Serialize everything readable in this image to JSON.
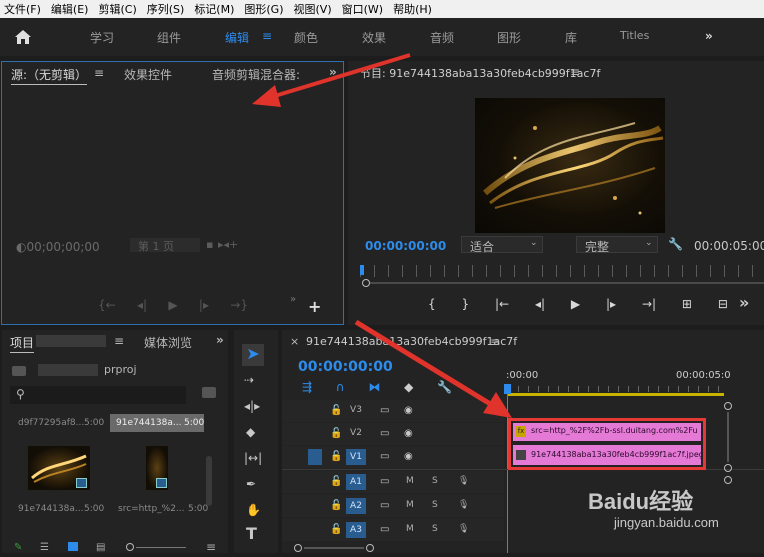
{
  "menu": [
    "文件(F)",
    "编辑(E)",
    "剪辑(C)",
    "序列(S)",
    "标记(M)",
    "图形(G)",
    "视图(V)",
    "窗口(W)",
    "帮助(H)"
  ],
  "workspace": {
    "tabs": [
      "学习",
      "组件",
      "编辑",
      "颜色",
      "效果",
      "音频",
      "图形",
      "库",
      "Titles"
    ],
    "active": "编辑"
  },
  "source_panel": {
    "tabs": [
      "源:（无剪辑）",
      "效果控件",
      "音频剪辑混合器:"
    ],
    "timecode": "00;00;00;00",
    "page": "第 1 页"
  },
  "program_panel": {
    "title": "节目: 91e744138aba13a30feb4cb999f1ac7f",
    "timecode": "00:00:00:00",
    "fit": "适合",
    "quality": "完整",
    "duration": "00:00:05:00"
  },
  "project_panel": {
    "tabs": [
      "项目",
      "媒体浏览"
    ],
    "project_name": "prproj",
    "items": [
      {
        "name": "d9f77295af8...",
        "dur": "5:00"
      },
      {
        "name": "91e744138a...",
        "dur": "5:00"
      },
      {
        "name": "91e744138a...",
        "dur": "5:00"
      },
      {
        "name": "src=http_%2...",
        "dur": "5:00"
      }
    ]
  },
  "timeline": {
    "title": "91e744138aba13a30feb4cb999f1ac7f",
    "timecode": "00:00:00:00",
    "ruler": [
      ":00:00",
      "00:00:05:0"
    ],
    "tracks": [
      "V3",
      "V2",
      "V1",
      "A1",
      "A2",
      "A3"
    ],
    "clips": [
      {
        "label": "src=http_%2F%2Fb-ssl.duitang.com%2Fu",
        "fx": "fx"
      },
      {
        "label": "91e744138aba13a30feb4cb999f1ac7f.jpeg"
      }
    ]
  },
  "watermark": {
    "brand": "Baidu经验",
    "url": "jingyan.baidu.com"
  },
  "colors": {
    "accent": "#2d8ceb",
    "clip": "#e57ad6",
    "highlight": "#e53935",
    "arrow": "#e0332b"
  }
}
